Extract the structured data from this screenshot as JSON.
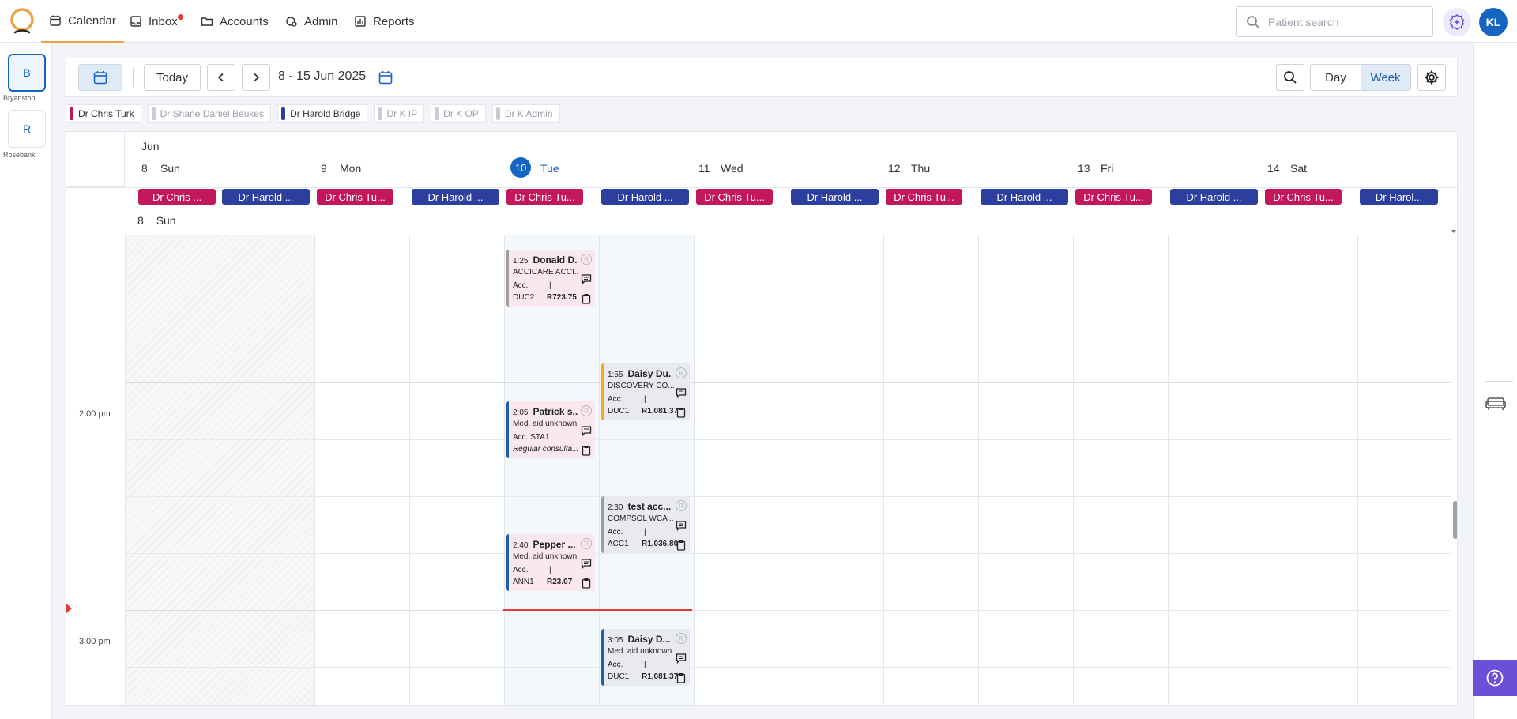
{
  "nav": {
    "items": [
      {
        "label": "Calendar",
        "active": true
      },
      {
        "label": "Inbox",
        "has_unread": true
      },
      {
        "label": "Accounts"
      },
      {
        "label": "Admin"
      },
      {
        "label": "Reports"
      }
    ],
    "search_placeholder": "Patient search",
    "user_initials": "KL"
  },
  "practices": [
    {
      "initial": "B",
      "label": "Bryanston",
      "selected": true
    },
    {
      "initial": "R",
      "label": "Rosebank",
      "selected": false
    }
  ],
  "toolbar": {
    "today_label": "Today",
    "date_range": "8 - 15 Jun 2025",
    "view_day": "Day",
    "view_week": "Week",
    "active_view": "Week"
  },
  "doctor_filters": [
    {
      "label": "Dr Chris Turk",
      "color": "#c2185b",
      "active": true
    },
    {
      "label": "Dr Shane Daniel Beukes",
      "color": "#c8ccd2",
      "active": false
    },
    {
      "label": "Dr Harold Bridge",
      "color": "#2c3e9e",
      "active": true
    },
    {
      "label": "Dr K IP",
      "color": "#c8ccd2",
      "active": false
    },
    {
      "label": "Dr K OP",
      "color": "#c8ccd2",
      "active": false
    },
    {
      "label": "Dr K Admin",
      "color": "#c8ccd2",
      "active": false
    }
  ],
  "calendar": {
    "month": "Jun",
    "days": [
      {
        "num": "8",
        "name": "Sun"
      },
      {
        "num": "9",
        "name": "Mon"
      },
      {
        "num": "10",
        "name": "Tue",
        "today": true
      },
      {
        "num": "11",
        "name": "Wed"
      },
      {
        "num": "12",
        "name": "Thu"
      },
      {
        "num": "13",
        "name": "Fri"
      },
      {
        "num": "14",
        "name": "Sat"
      }
    ],
    "doctor_columns": [
      "Dr Chris ...",
      "Dr Harold ...",
      "Dr Chris Tu...",
      "Dr Harold ...",
      "Dr Chris Tu...",
      "Dr Harold ...",
      "Dr Chris Tu...",
      "Dr Harold ...",
      "Dr Chris Tu...",
      "Dr Harold ...",
      "Dr Chris Tu...",
      "Dr Harold ...",
      "Dr Chris Tu...",
      "Dr Harol..."
    ],
    "sticky_day": {
      "num": "8",
      "name": "Sun"
    },
    "time_labels": [
      "2:00 pm",
      "3:00 pm"
    ]
  },
  "appointments": [
    {
      "time": "1:25",
      "name": "Donald D...",
      "line2": "ACCICARE ACCI...",
      "acc": "Acc.",
      "code": "DUC2",
      "amount": "R723.75",
      "stripe": "#9e9e9e",
      "bg": "pink"
    },
    {
      "time": "1:55",
      "name": "Daisy Du...",
      "line2": "DISCOVERY CO...",
      "acc": "Acc.",
      "code": "DUC1",
      "amount": "R1,081.37",
      "stripe": "#f5a623",
      "bg": "grey"
    },
    {
      "time": "2:05",
      "name": "Patrick s...",
      "line2": "Med. aid unknown",
      "acc": "Acc. STA1",
      "note": "Regular consulta...",
      "stripe": "#1e5fa8",
      "bg": "pink"
    },
    {
      "time": "2:30",
      "name": "test acc...",
      "line2": "COMPSOL WCA ...",
      "acc": "Acc.",
      "code": "ACC1",
      "amount": "R1,036.80",
      "stripe": "#9e9e9e",
      "bg": "grey"
    },
    {
      "time": "2:40",
      "name": "Pepper ...",
      "line2": "Med. aid unknown",
      "acc": "Acc.",
      "code": "ANN1",
      "amount": "R23.07",
      "stripe": "#1e5fa8",
      "bg": "pink"
    },
    {
      "time": "3:05",
      "name": "Daisy D...",
      "line2": "Med. aid unknown",
      "acc": "Acc.",
      "code": "DUC1",
      "amount": "R1,081.37",
      "stripe": "#1e5fa8",
      "bg": "grey"
    }
  ],
  "icons": {
    "calendar": "calendar-icon",
    "inbox": "inbox-icon",
    "accounts": "folder-icon",
    "admin": "admin-icon",
    "reports": "chart-icon",
    "search": "search-icon",
    "settings": "gear-icon",
    "help": "help-icon",
    "sofa": "sofa-icon"
  },
  "colors": {
    "brand_orange": "#f0a24a",
    "primary_blue": "#1565c0",
    "now_line": "#e53935",
    "help_purple": "#6a4fd8"
  }
}
